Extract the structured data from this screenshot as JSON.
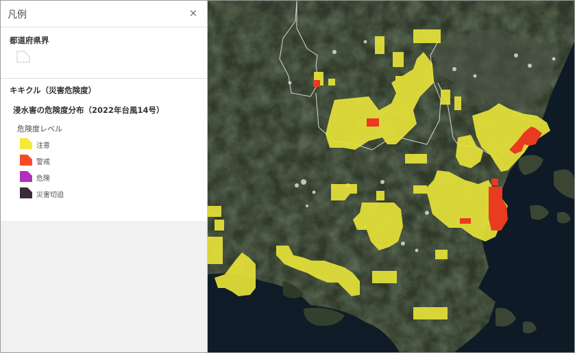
{
  "legend": {
    "title": "凡例",
    "close_label": "×",
    "layers": {
      "prefecture": {
        "title": "都道府県界"
      },
      "kikikuru": {
        "title": "キキクル（災害危険度）",
        "sublayer_title": "浸水害の危険度分布（2022年台風14号）",
        "field_label": "危険度レベル",
        "items": [
          {
            "label": "注意",
            "color": "#f5e93a"
          },
          {
            "label": "警戒",
            "color": "#f64b26"
          },
          {
            "label": "危険",
            "color": "#b12fbd"
          },
          {
            "label": "災害切迫",
            "color": "#3b2b37"
          }
        ]
      }
    }
  },
  "map": {
    "basemap": "satellite-imagery",
    "colors": {
      "land": "#2f3829",
      "sea": "#0e1a26",
      "boundary": "#d8d8d8",
      "caution": "#e6e23a",
      "warning": "#e83b1f"
    }
  }
}
